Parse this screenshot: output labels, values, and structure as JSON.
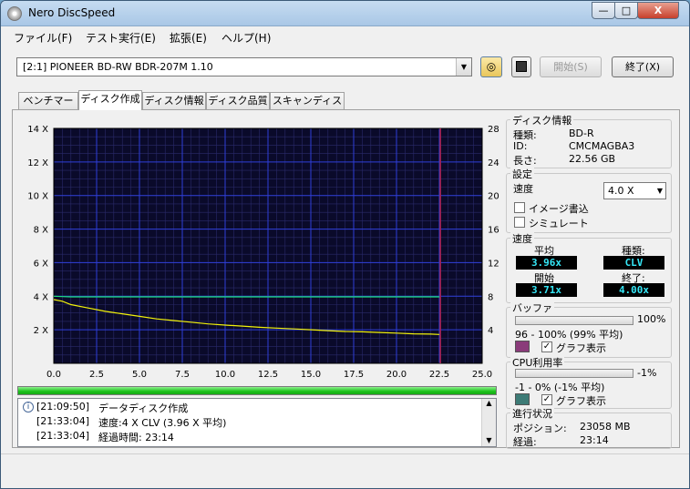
{
  "window": {
    "title": "Nero DiscSpeed",
    "min": "—",
    "max": "□",
    "close": "X"
  },
  "menu": [
    {
      "label": "ファイル(F)"
    },
    {
      "label": "テスト実行(E)"
    },
    {
      "label": "拡張(E)"
    },
    {
      "label": "ヘルプ(H)"
    }
  ],
  "toolbar": {
    "drive": "[2:1]   PIONEER BD-RW   BDR-207M 1.10",
    "start_label": "開始(S)",
    "end_label": "終了(X)"
  },
  "tabs": [
    {
      "label": "ベンチマーク"
    },
    {
      "label": "ディスク作成"
    },
    {
      "label": "ディスク情報"
    },
    {
      "label": "ディスク品質"
    },
    {
      "label": "スキャンディスク"
    }
  ],
  "chart_data": {
    "type": "line",
    "x_ticks": [
      "0.0",
      "2.5",
      "5.0",
      "7.5",
      "10.0",
      "12.5",
      "15.0",
      "17.5",
      "20.0",
      "22.5",
      "25.0"
    ],
    "y_left_ticks": [
      "2 X",
      "4 X",
      "6 X",
      "8 X",
      "10 X",
      "12 X",
      "14 X"
    ],
    "y_right_ticks": [
      "4",
      "8",
      "12",
      "16",
      "20",
      "24",
      "28"
    ],
    "xlim": [
      0,
      25
    ],
    "ylim": [
      0,
      14
    ],
    "ylim_right": [
      0,
      28
    ],
    "grid": true,
    "marker_x": 22.56,
    "series": [
      {
        "color": "#f2f20a",
        "x": [
          0,
          0.5,
          1,
          2,
          3,
          4,
          5,
          6,
          7,
          8,
          9,
          10,
          11,
          12,
          13,
          14,
          15,
          16,
          17,
          18,
          19,
          20,
          21,
          22,
          22.5
        ],
        "y": [
          3.8,
          3.7,
          3.5,
          3.3,
          3.1,
          2.95,
          2.8,
          2.65,
          2.55,
          2.45,
          2.35,
          2.28,
          2.22,
          2.15,
          2.1,
          2.05,
          2.0,
          1.95,
          1.9,
          1.88,
          1.84,
          1.8,
          1.76,
          1.74,
          1.72
        ]
      },
      {
        "color": "#1be27a",
        "x": [
          0,
          0.5,
          1,
          2,
          5,
          10,
          15,
          20,
          22.5
        ],
        "y": [
          4.0,
          3.98,
          3.96,
          3.96,
          3.96,
          3.96,
          3.96,
          3.96,
          3.96
        ]
      }
    ]
  },
  "progress": {
    "fraction": 1.0
  },
  "log": [
    {
      "time": "[21:09:50]",
      "text": "データディスク作成"
    },
    {
      "time": "[21:33:04]",
      "text": "速度:4 X CLV (3.96 X 平均)"
    },
    {
      "time": "[21:33:04]",
      "text": "経過時間: 23:14"
    }
  ],
  "disc_info": {
    "title": "ディスク情報",
    "type_label": "種類:",
    "type_value": "BD-R",
    "id_label": "ID:",
    "id_value": "CMCMAGBA3",
    "length_label": "長さ:",
    "length_value": "22.56 GB"
  },
  "settings": {
    "title": "設定",
    "speed_label": "速度",
    "speed_value": "4.0 X",
    "image_write": "イメージ書込",
    "simulate": "シミュレート"
  },
  "speed": {
    "title": "速度",
    "avg_label": "平均",
    "avg_value": "3.96x",
    "type_label": "種類:",
    "type_value": "CLV",
    "start_label": "開始",
    "start_value": "3.71x",
    "end_label": "終了:",
    "end_value": "4.00x"
  },
  "buffer": {
    "title": "バッファ",
    "percent": "100%",
    "range": "96 - 100% (99% 平均)",
    "color": "#8a3b7a",
    "graph_label": "グラフ表示"
  },
  "cpu": {
    "title": "CPU利用率",
    "percent": "-1%",
    "range": "-1 - 0% (-1% 平均)",
    "color": "#3d7b76",
    "graph_label": "グラフ表示"
  },
  "status": {
    "title": "進行状況",
    "pos_label": "ポジション:",
    "pos_value": "23058 MB",
    "elapsed_label": "経過:",
    "elapsed_value": "23:14"
  }
}
